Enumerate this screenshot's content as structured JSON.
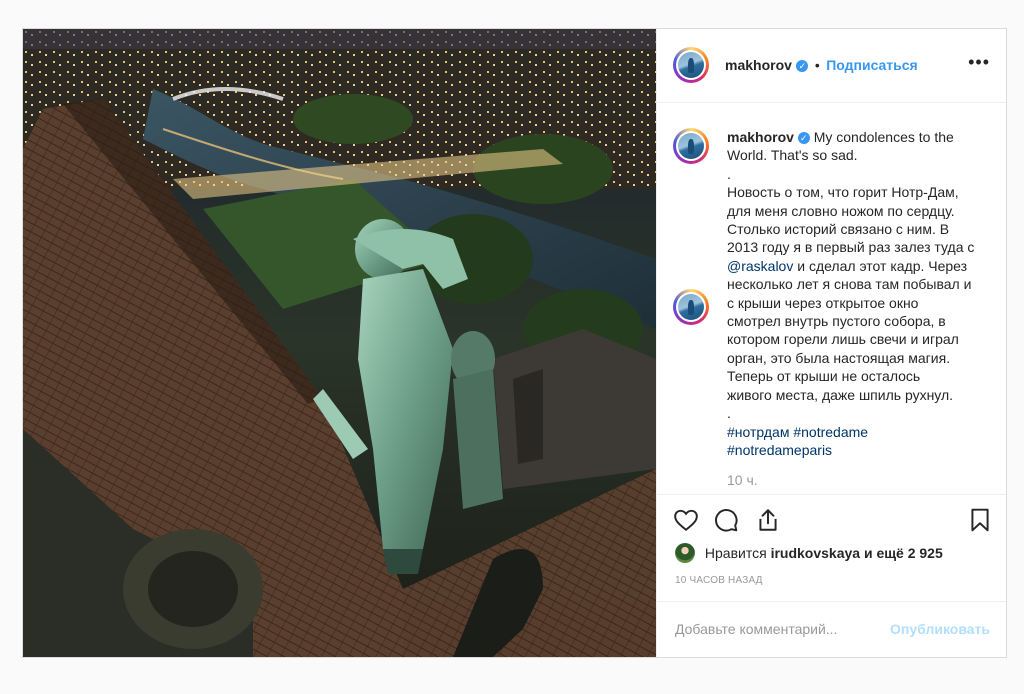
{
  "post": {
    "username": "makhorov",
    "verified_mark": "✓",
    "follow_separator": "•",
    "follow_label": "Подписаться",
    "more_label": "•••",
    "caption_lines": [
      "My condolences to the",
      "World. That's so sad.",
      ".",
      "Новость о том, что горит Нотр-Дам,",
      "для меня словно ножом по сердцу.",
      "Столько историй связано с ним. В",
      "2013 году я в первый раз залез туда с",
      "и сделал этот кадр. Через",
      "несколько лет я снова там побывал и",
      "с крыши через открытое окно",
      "смотрел внутрь пустого собора, в",
      "котором горели лишь свечи и играл",
      "орган, это была настоящая магия.",
      "Теперь от крыши не осталось",
      "живого места, даже шпиль рухнул.",
      "."
    ],
    "mention": "@raskalov",
    "hashtags_line1": "#нотрдам #notredame",
    "hashtags_line2": "#notredameparis",
    "time_ago": "10 ч.",
    "likes_prefix": "Нравится",
    "likes_user": "irudkovskaya",
    "likes_suffix": "и ещё 2 925",
    "date_label": "10 ЧАСОВ НАЗАД",
    "comment_placeholder": "Добавьте комментарий...",
    "publish_label": "Опубликовать"
  },
  "colors": {
    "link": "#3897f0",
    "hashtag": "#003569",
    "publish_disabled": "#b2dffc",
    "muted": "#999999"
  },
  "icons": [
    "more-options-icon",
    "verified-icon",
    "heart-icon",
    "comment-icon",
    "share-icon",
    "bookmark-icon"
  ]
}
